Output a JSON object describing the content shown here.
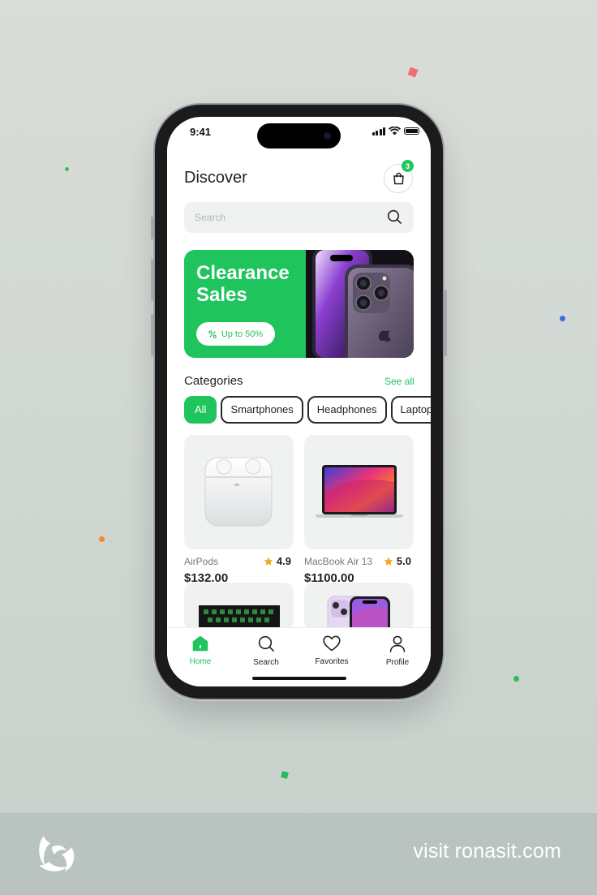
{
  "status_bar": {
    "time": "9:41"
  },
  "header": {
    "title": "Discover",
    "cart_count": "3"
  },
  "search": {
    "placeholder": "Search"
  },
  "banner": {
    "title": "Clearance Sales",
    "pill_label": "Up to 50%"
  },
  "categories": {
    "title": "Categories",
    "see_all": "See all",
    "chips": [
      "All",
      "Smartphones",
      "Headphones",
      "Laptops"
    ]
  },
  "products": [
    {
      "name": "AirPods",
      "rating": "4.9",
      "price": "$132.00"
    },
    {
      "name": "MacBook Air 13",
      "rating": "5.0",
      "price": "$1100.00"
    }
  ],
  "tabbar": {
    "items": [
      "Home",
      "Search",
      "Favorites",
      "Profile"
    ]
  },
  "footer": {
    "link": "visit ronasit.com"
  },
  "colors": {
    "accent": "#1fc45c",
    "background": "#d3d9d5",
    "footer": "#b9c4c1"
  }
}
